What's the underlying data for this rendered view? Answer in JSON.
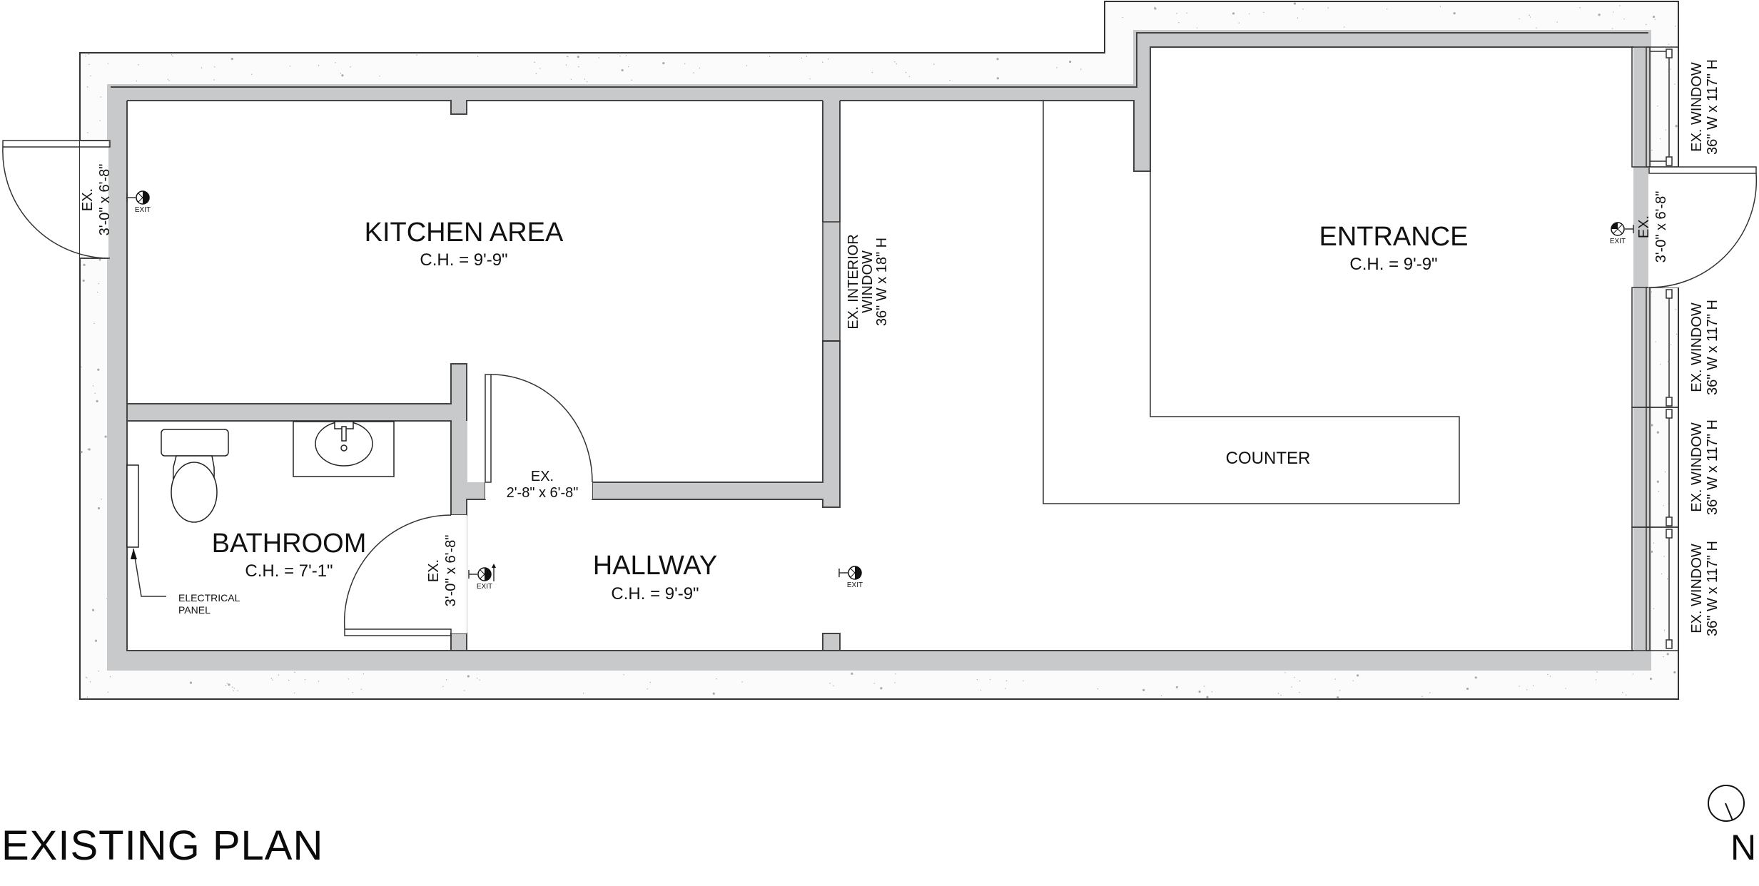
{
  "title": "EXISTING PLAN",
  "north_label": "N",
  "colors": {
    "wall_fill": "#c8c9cb",
    "concrete_fill": "#fbfbfb",
    "line": "#333333",
    "text": "#111111"
  },
  "rooms": {
    "kitchen": {
      "name": "KITCHEN AREA",
      "ceiling_height": "C.H. = 9'-9\""
    },
    "entrance": {
      "name": "ENTRANCE",
      "ceiling_height": "C.H. = 9'-9\""
    },
    "bathroom": {
      "name": "BATHROOM",
      "ceiling_height": "C.H. = 7'-1\""
    },
    "hallway": {
      "name": "HALLWAY",
      "ceiling_height": "C.H. = 9'-9\""
    }
  },
  "counter": {
    "label": "COUNTER"
  },
  "doors": {
    "west_exit": {
      "line1": "EX.",
      "line2": "3'-0\" x 6'-8\""
    },
    "east_exit": {
      "line1": "EX.",
      "line2": "3'-0\" x 6'-8\""
    },
    "bathroom_door": {
      "line1": "EX.",
      "line2": "3'-0\" x 6'-8\""
    },
    "kitchen_door": {
      "line1": "EX.",
      "line2": "2'-8\" x 6'-8\""
    }
  },
  "windows": {
    "interior": {
      "line1": "EX. INTERIOR",
      "line2": "WINDOW",
      "line3": "36\" W x 18\" H"
    },
    "east": [
      {
        "line1": "EX. WINDOW",
        "line2": "36\" W x 117\" H"
      },
      {
        "line1": "EX. WINDOW",
        "line2": "36\" W x 117\" H"
      },
      {
        "line1": "EX. WINDOW",
        "line2": "36\" W x 117\" H"
      },
      {
        "line1": "EX. WINDOW",
        "line2": "36\" W x 117\" H"
      }
    ]
  },
  "exit_sign_label": "EXIT",
  "electrical_panel": {
    "line1": "ELECTRICAL",
    "line2": "PANEL"
  }
}
